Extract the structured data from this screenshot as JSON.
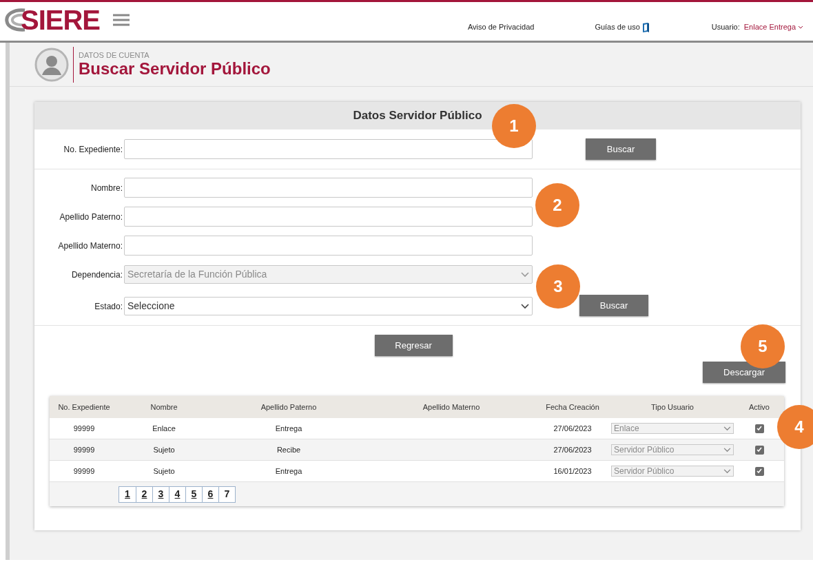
{
  "header": {
    "logo": "SIERE",
    "links": [
      {
        "label": "Aviso de Privacidad",
        "kind": "text"
      },
      {
        "label": "Guías de uso",
        "kind": "book"
      }
    ],
    "user_label": "Usuario:",
    "user_name": "Enlace Entrega"
  },
  "page": {
    "section": "DATOS DE CUENTA",
    "title": "Buscar Servidor Público"
  },
  "form": {
    "title": "Datos Servidor Público",
    "expediente_label": "No. Expediente:",
    "search_button": "Buscar",
    "fields": [
      {
        "kind": "text",
        "label": "Nombre:"
      },
      {
        "kind": "text",
        "label": "Apellido Paterno:"
      },
      {
        "kind": "text",
        "label": "Apellido Materno:"
      },
      {
        "kind": "select",
        "label": "Dependencia:",
        "value": "Secretaría de la Función Pública",
        "disabled": true
      },
      {
        "kind": "select",
        "label": "Estado:",
        "value": "Seleccione",
        "disabled": false
      }
    ],
    "search_button_2": "Buscar",
    "back_button": "Regresar",
    "download_button": "Descargar"
  },
  "table": {
    "columns": [
      "No. Expediente",
      "Nombre",
      "Apellido Paterno",
      "Apellido Materno",
      "Fecha Creación",
      "Tipo Usuario",
      "Activo"
    ],
    "rows": [
      {
        "expediente": "99999",
        "nombre": "Enlace",
        "apellido_paterno": "Entrega",
        "fecha": "27/06/2023",
        "tipo": "Enlace",
        "activo": true
      },
      {
        "expediente": "99999",
        "nombre": "Sujeto",
        "apellido_paterno": "Recibe",
        "fecha": "27/06/2023",
        "tipo": "Servidor Público",
        "activo": true
      },
      {
        "expediente": "99999",
        "nombre": "Sujeto",
        "apellido_paterno": "Entrega",
        "fecha": "16/01/2023",
        "tipo": "Servidor Público",
        "activo": true
      }
    ],
    "pagination": [
      {
        "label": "1",
        "selected": false
      },
      {
        "label": "2",
        "selected": false
      },
      {
        "label": "3",
        "selected": false
      },
      {
        "label": "4",
        "selected": false
      },
      {
        "label": "5",
        "selected": false
      },
      {
        "label": "6",
        "selected": false
      },
      {
        "label": "7",
        "selected": true
      }
    ]
  },
  "callouts": [
    "1",
    "2",
    "3",
    "4",
    "5"
  ]
}
